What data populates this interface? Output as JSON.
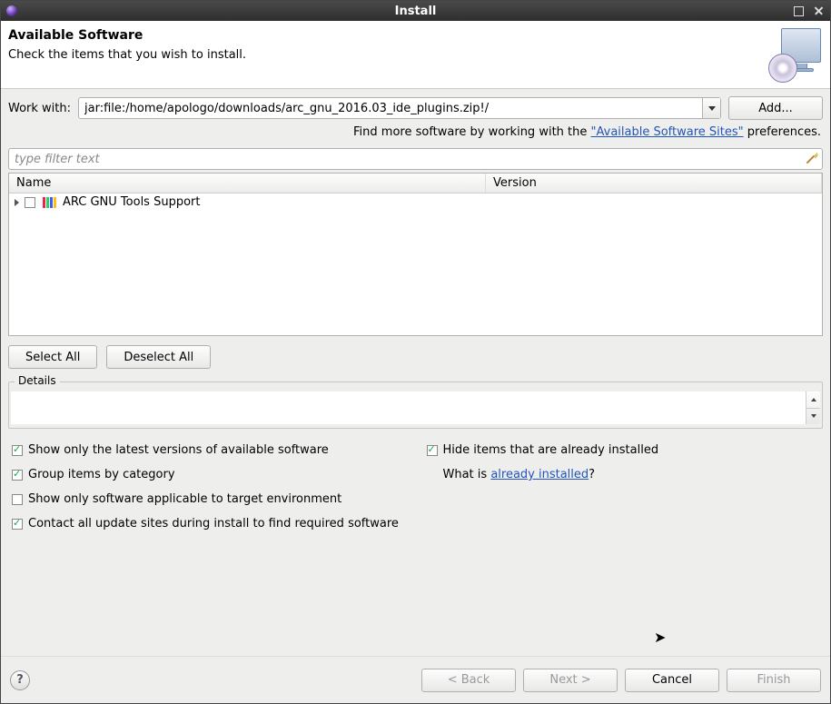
{
  "titlebar": {
    "title": "Install"
  },
  "header": {
    "title": "Available Software",
    "subtitle": "Check the items that you wish to install."
  },
  "work_with": {
    "label": "Work with:",
    "value": "jar:file:/home/apologo/downloads/arc_gnu_2016.03_ide_plugins.zip!/",
    "add_label": "Add..."
  },
  "hint": {
    "prefix": "Find more software by working with the ",
    "link": "\"Available Software Sites\"",
    "suffix": " preferences."
  },
  "filter": {
    "placeholder": "type filter text"
  },
  "columns": {
    "name": "Name",
    "version": "Version"
  },
  "tree": {
    "items": [
      {
        "label": "ARC GNU Tools Support",
        "checked": false,
        "expanded": false
      }
    ]
  },
  "buttons": {
    "select_all": "Select All",
    "deselect_all": "Deselect All"
  },
  "details": {
    "legend": "Details"
  },
  "options": {
    "latest_only": {
      "label": "Show only the latest versions of available software",
      "checked": true
    },
    "group_category": {
      "label": "Group items by category",
      "checked": true
    },
    "target_env_only": {
      "label": "Show only software applicable to target environment",
      "checked": false
    },
    "contact_all": {
      "label": "Contact all update sites during install to find required software",
      "checked": true
    },
    "hide_installed": {
      "label": "Hide items that are already installed",
      "checked": true
    },
    "what_is_prefix": "What is ",
    "what_is_link": "already installed",
    "what_is_suffix": "?"
  },
  "footer": {
    "back": "< Back",
    "next": "Next >",
    "cancel": "Cancel",
    "finish": "Finish"
  }
}
